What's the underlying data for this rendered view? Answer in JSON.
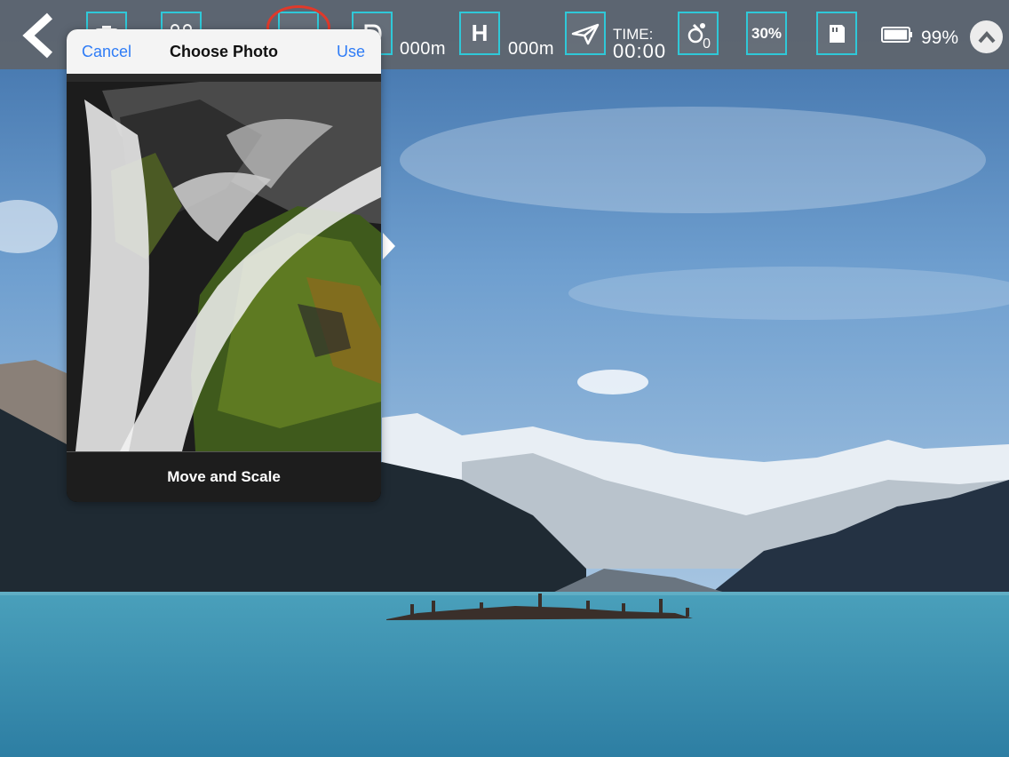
{
  "toolbar": {
    "distance_value": "000m",
    "height_button": "H",
    "height_value": "000m",
    "time_label": "TIME:",
    "time_value": "00:00",
    "satellite_count": "0",
    "zoom_button": "30%",
    "battery_percent": "99%",
    "battery_level": 0.99
  },
  "popover": {
    "cancel_label": "Cancel",
    "title": "Choose Photo",
    "use_label": "Use",
    "footer_label": "Move and Scale"
  },
  "icons": [
    "back-chevron-icon",
    "camera-icon",
    "drone-icon",
    "menu-icon",
    "distance-icon",
    "height-icon",
    "send-icon",
    "satellite-icon",
    "sd-card-icon",
    "battery-icon",
    "chevron-up-icon"
  ],
  "colors": {
    "accent_border": "#2fc8d8",
    "ios_blue": "#2f7cf6",
    "highlight_circle": "#e0392a",
    "toolbar_bg": "#5f646a"
  }
}
